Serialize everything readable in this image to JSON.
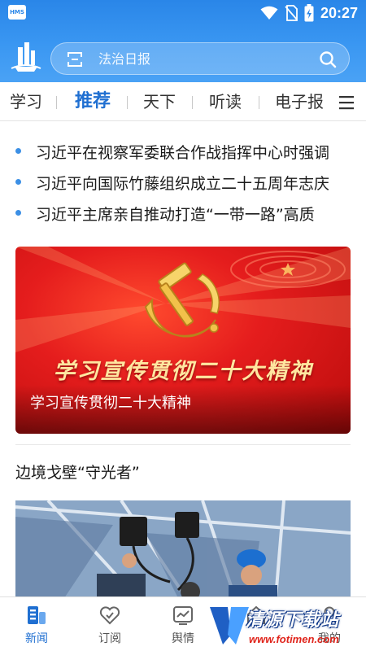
{
  "status_bar": {
    "app_badge": "HMS",
    "time": "20:27"
  },
  "search": {
    "placeholder": "法治日报"
  },
  "tabs": [
    {
      "label": "学习"
    },
    {
      "label": "推荐",
      "active": true
    },
    {
      "label": "天下"
    },
    {
      "label": "听读"
    },
    {
      "label": "电子报"
    }
  ],
  "tabs_more_icon": "menu-icon",
  "headlines": [
    {
      "text": "习近平在视察军委联合作战指挥中心时强调"
    },
    {
      "text": "习近平向国际竹藤组织成立二十五周年志庆"
    },
    {
      "text": "习近平主席亲自推动打造“一带一路”高质"
    }
  ],
  "banner": {
    "slogan": "学习宣传贯彻二十大精神",
    "caption": "学习宣传贯彻二十大精神",
    "emblem_icon": "hammer-sickle-icon"
  },
  "article": {
    "title": "边境戈壁“守光者”"
  },
  "bottom_nav": [
    {
      "label": "新闻",
      "icon": "news-icon",
      "active": true
    },
    {
      "label": "订阅",
      "icon": "heart-icon"
    },
    {
      "label": "舆情",
      "icon": "chart-icon"
    },
    {
      "label": "",
      "icon": "home-icon"
    },
    {
      "label": "我的",
      "icon": "user-icon"
    }
  ],
  "watermark": {
    "title": "清源下载站",
    "url": "www.fotimen.com"
  },
  "colors": {
    "header_blue": "#2a86e8",
    "accent_blue": "#1f6fd1",
    "banner_red": "#e51d1d"
  }
}
